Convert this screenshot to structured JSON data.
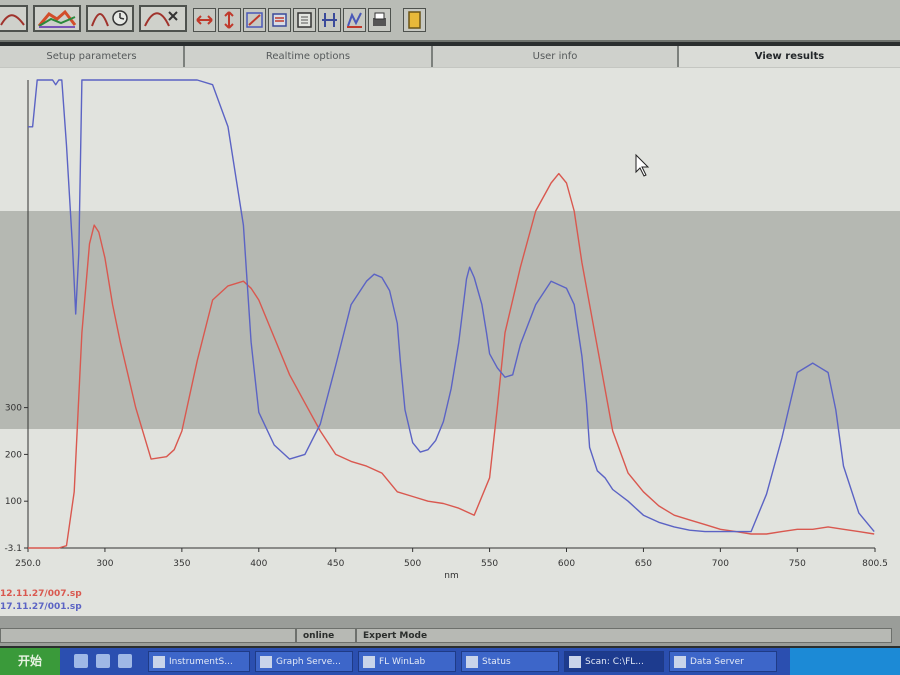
{
  "tabs": [
    {
      "label": "Setup parameters",
      "active": false
    },
    {
      "label": "Realtime options",
      "active": false
    },
    {
      "label": "User info",
      "active": false
    },
    {
      "label": "View results",
      "active": true
    }
  ],
  "chart_data": {
    "type": "line",
    "xlabel": "nm",
    "xlim": [
      250,
      800.5
    ],
    "ylim": [
      -3.1,
      1000
    ],
    "x_ticks": [
      "250.0",
      "300",
      "350",
      "400",
      "450",
      "500",
      "550",
      "600",
      "650",
      "700",
      "750",
      "800.5"
    ],
    "y_ticks": [
      "-3.1",
      "100",
      "200",
      "300"
    ],
    "series": [
      {
        "name": "12.11.27/007.sp",
        "color": "#d9584f",
        "x": [
          250,
          260,
          270,
          275,
          280,
          285,
          290,
          293,
          296,
          300,
          305,
          310,
          320,
          330,
          340,
          345,
          350,
          360,
          370,
          380,
          390,
          395,
          400,
          410,
          420,
          430,
          440,
          450,
          460,
          470,
          480,
          490,
          500,
          510,
          520,
          530,
          540,
          550,
          555,
          560,
          570,
          580,
          590,
          595,
          600,
          605,
          610,
          620,
          630,
          640,
          650,
          660,
          670,
          680,
          690,
          700,
          710,
          720,
          730,
          740,
          750,
          760,
          770,
          780,
          790,
          800
        ],
        "y": [
          0,
          0,
          0,
          5,
          120,
          460,
          650,
          690,
          675,
          620,
          520,
          440,
          300,
          190,
          195,
          210,
          250,
          400,
          530,
          560,
          570,
          555,
          530,
          450,
          370,
          310,
          250,
          200,
          185,
          175,
          160,
          120,
          110,
          100,
          95,
          85,
          70,
          150,
          300,
          460,
          600,
          720,
          780,
          800,
          780,
          720,
          610,
          430,
          250,
          160,
          120,
          90,
          70,
          60,
          50,
          40,
          35,
          30,
          30,
          35,
          40,
          40,
          45,
          40,
          35,
          30
        ]
      },
      {
        "name": "17.11.27/001.sp",
        "color": "#5b63c4",
        "x": [
          250,
          253,
          256,
          260,
          264,
          266,
          268,
          270,
          272,
          275,
          279,
          281,
          283,
          285,
          290,
          296,
          300,
          305,
          310,
          315,
          320,
          330,
          340,
          350,
          360,
          370,
          380,
          390,
          395,
          400,
          410,
          420,
          430,
          440,
          450,
          460,
          470,
          475,
          480,
          485,
          490,
          492,
          495,
          500,
          505,
          510,
          515,
          520,
          525,
          530,
          533,
          535,
          537,
          540,
          545,
          548,
          550,
          555,
          560,
          565,
          570,
          580,
          590,
          600,
          605,
          610,
          613,
          615,
          620,
          625,
          630,
          640,
          650,
          660,
          670,
          680,
          690,
          700,
          710,
          720,
          730,
          740,
          750,
          760,
          765,
          770,
          775,
          780,
          790,
          800
        ],
        "y": [
          900,
          900,
          1000,
          1000,
          1000,
          1000,
          990,
          1000,
          1000,
          860,
          640,
          500,
          630,
          1000,
          1000,
          1000,
          1000,
          1000,
          1000,
          1000,
          1000,
          1000,
          1000,
          1000,
          1000,
          990,
          900,
          690,
          440,
          290,
          220,
          190,
          200,
          265,
          390,
          520,
          570,
          585,
          578,
          550,
          480,
          400,
          295,
          225,
          205,
          210,
          230,
          270,
          340,
          440,
          520,
          575,
          600,
          578,
          520,
          460,
          415,
          385,
          365,
          370,
          435,
          520,
          570,
          555,
          520,
          410,
          310,
          215,
          165,
          150,
          125,
          100,
          70,
          55,
          45,
          38,
          35,
          35,
          35,
          35,
          115,
          235,
          375,
          395,
          385,
          375,
          295,
          175,
          75,
          35
        ]
      }
    ]
  }
}
